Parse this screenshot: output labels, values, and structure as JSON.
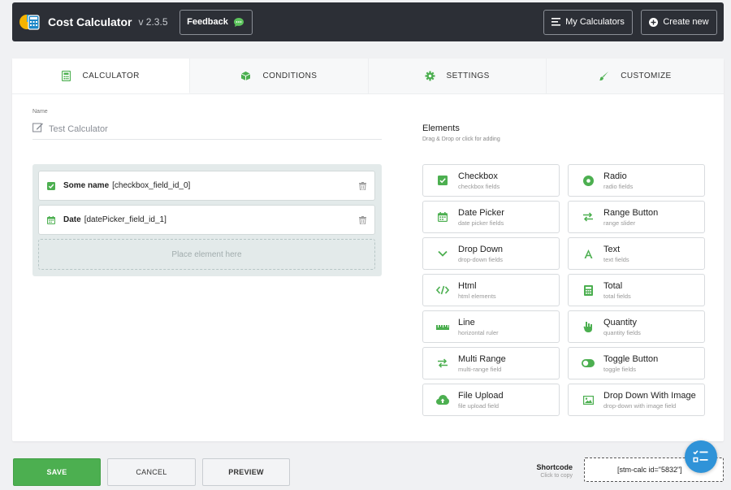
{
  "header": {
    "title": "Cost Calculator",
    "version": "v 2.3.5",
    "feedback_label": "Feedback",
    "my_calculators_label": "My Calculators",
    "create_new_label": "Create new"
  },
  "tabs": [
    {
      "label": "CALCULATOR",
      "icon": "calculator-icon"
    },
    {
      "label": "CONDITIONS",
      "icon": "cube-icon"
    },
    {
      "label": "SETTINGS",
      "icon": "gear-icon"
    },
    {
      "label": "CUSTOMIZE",
      "icon": "brush-icon"
    }
  ],
  "form": {
    "name_label": "Name",
    "name_value": "Test Calculator",
    "fields": [
      {
        "name": "Some name",
        "id": "[checkbox_field_id_0]",
        "icon": "checkbox-icon"
      },
      {
        "name": "Date",
        "id": "[datePicker_field_id_1]",
        "icon": "calendar-icon"
      }
    ],
    "placeholder": "Place element here"
  },
  "elements": {
    "title": "Elements",
    "subtitle": "Drag & Drop or click for adding",
    "items": [
      {
        "name": "Checkbox",
        "desc": "checkbox fields",
        "icon": "checkbox-icon"
      },
      {
        "name": "Radio",
        "desc": "radio fields",
        "icon": "radio-icon"
      },
      {
        "name": "Date Picker",
        "desc": "date picker fields",
        "icon": "calendar-icon"
      },
      {
        "name": "Range Button",
        "desc": "range slider",
        "icon": "arrows-icon"
      },
      {
        "name": "Drop Down",
        "desc": "drop-down fields",
        "icon": "chevron-down-icon"
      },
      {
        "name": "Text",
        "desc": "text fields",
        "icon": "text-icon"
      },
      {
        "name": "Html",
        "desc": "html elements",
        "icon": "code-icon"
      },
      {
        "name": "Total",
        "desc": "total fields",
        "icon": "calculator-icon"
      },
      {
        "name": "Line",
        "desc": "horizontal ruler",
        "icon": "ruler-icon"
      },
      {
        "name": "Quantity",
        "desc": "quantity fields",
        "icon": "hand-icon"
      },
      {
        "name": "Multi Range",
        "desc": "multi-range field",
        "icon": "arrows-icon"
      },
      {
        "name": "Toggle Button",
        "desc": "toggle fields",
        "icon": "toggle-icon"
      },
      {
        "name": "File Upload",
        "desc": "file upload field",
        "icon": "cloud-upload-icon"
      },
      {
        "name": "Drop Down With Image",
        "desc": "drop-down with image field",
        "icon": "image-icon"
      }
    ]
  },
  "footer": {
    "save_label": "SAVE",
    "cancel_label": "CANCEL",
    "preview_label": "PREVIEW",
    "shortcode_label": "Shortcode",
    "shortcode_sub": "Click to copy",
    "shortcode_value": "[stm-calc id=\"5832\"]"
  },
  "colors": {
    "accent": "#4caf50",
    "fab": "#2f93d8",
    "topbar": "#2c2f36"
  }
}
